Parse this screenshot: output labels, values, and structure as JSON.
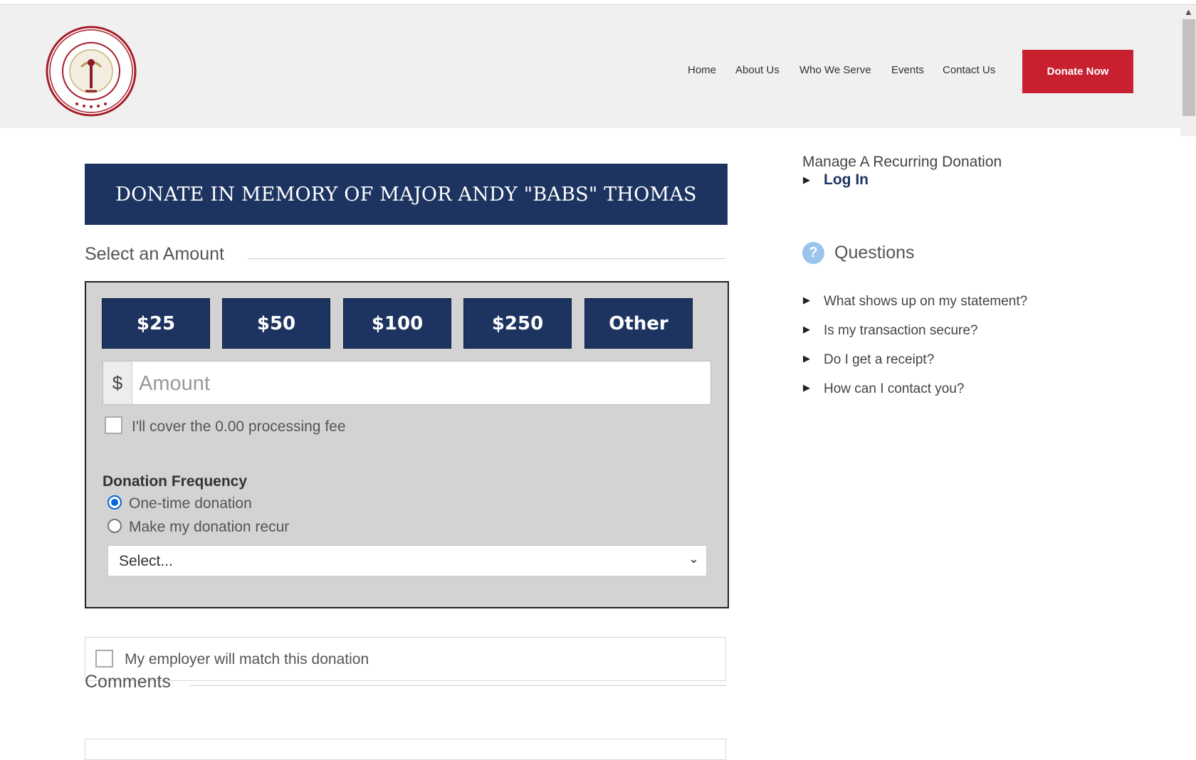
{
  "header": {
    "logo_text": "MARINE CORPS - LAW ENFORCEMENT FOUNDATION",
    "nav": [
      "Home",
      "About Us",
      "Who We Serve",
      "Events",
      "Contact Us"
    ],
    "donate_button": "Donate Now"
  },
  "colors": {
    "navy": "#1d3461",
    "brand_red": "#c8202f",
    "panel_gray": "#d3d3d3",
    "radio_blue": "#0a66d6"
  },
  "main": {
    "banner_title": "DONATE IN MEMORY OF MAJOR ANDY \"BABS\" THOMAS",
    "select_amount_heading": "Select an Amount",
    "amount_buttons": [
      "$25",
      "$50",
      "$100",
      "$250",
      "Other"
    ],
    "currency_symbol": "$",
    "amount_placeholder": "Amount",
    "cover_fee_label": "I'll cover the 0.00 processing fee",
    "frequency_heading": "Donation Frequency",
    "frequency_options": [
      "One-time donation",
      "Make my donation recur"
    ],
    "frequency_selected": "One-time donation",
    "recur_select_value": "Select...",
    "employer_match_label": "My employer will match this donation",
    "comments_heading": "Comments"
  },
  "sidebar": {
    "manage_title": "Manage A Recurring Donation",
    "login_link": "Log In",
    "questions_heading": "Questions",
    "faqs": [
      "What shows up on my statement?",
      "Is my transaction secure?",
      "Do I get a receipt?",
      "How can I contact you?"
    ]
  }
}
